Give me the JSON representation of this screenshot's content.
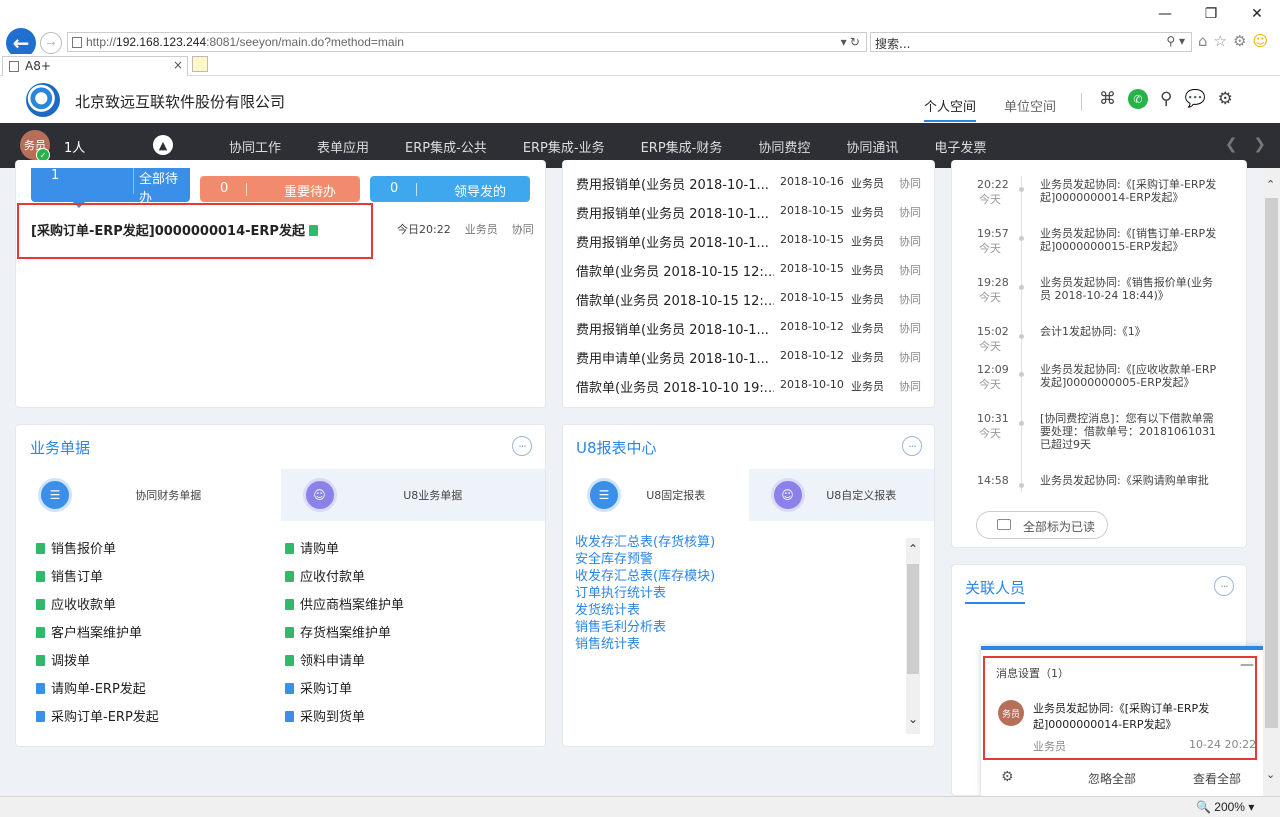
{
  "browser": {
    "url_prefix": "http://",
    "url_host": "192.168.123.244",
    "url_rest": ":8081/seeyon/main.do?method=main",
    "search_placeholder": "搜索...",
    "tab_title": "A8+",
    "zoom": "200%"
  },
  "header": {
    "company": "北京致远互联软件股份有限公司",
    "space_tabs": [
      "个人空间",
      "单位空间"
    ]
  },
  "nav": {
    "avatar_text": "务员",
    "user_count": "1人",
    "items": [
      "协同工作",
      "表单应用",
      "ERP集成-公共",
      "ERP集成-业务",
      "ERP集成-财务",
      "协同费控",
      "协同通讯",
      "电子发票"
    ]
  },
  "todo": {
    "all": {
      "count": "1",
      "label": "全部待办"
    },
    "important": {
      "count": "0",
      "label": "重要待办"
    },
    "leader": {
      "count": "0",
      "label": "领导发的"
    },
    "item": {
      "title": "[采购订单-ERP发起]0000000014-ERP发起",
      "time": "今日20:22",
      "user": "业务员",
      "type": "协同"
    }
  },
  "expenses": [
    {
      "title": "费用报销单(业务员 2018-10-1...",
      "date": "2018-10-16",
      "user": "业务员",
      "type": "协同"
    },
    {
      "title": "费用报销单(业务员 2018-10-1...",
      "date": "2018-10-15",
      "user": "业务员",
      "type": "协同"
    },
    {
      "title": "费用报销单(业务员 2018-10-1...",
      "date": "2018-10-15",
      "user": "业务员",
      "type": "协同"
    },
    {
      "title": "借款单(业务员 2018-10-15 12:...",
      "date": "2018-10-15",
      "user": "业务员",
      "type": "协同"
    },
    {
      "title": "借款单(业务员 2018-10-15 12:...",
      "date": "2018-10-15",
      "user": "业务员",
      "type": "协同"
    },
    {
      "title": "费用报销单(业务员 2018-10-1...",
      "date": "2018-10-12",
      "user": "业务员",
      "type": "协同"
    },
    {
      "title": "费用申请单(业务员 2018-10-1...",
      "date": "2018-10-12",
      "user": "业务员",
      "type": "协同"
    },
    {
      "title": "借款单(业务员 2018-10-10 19:...",
      "date": "2018-10-10",
      "user": "业务员",
      "type": "协同"
    }
  ],
  "timeline": {
    "today": "今天",
    "items": [
      {
        "time": "20:22",
        "text": "业务员发起协同:《[采购订单-ERP发起]0000000014-ERP发起》"
      },
      {
        "time": "19:57",
        "text": "业务员发起协同:《[销售订单-ERP发起]0000000015-ERP发起》"
      },
      {
        "time": "19:28",
        "text": "业务员发起协同:《销售报价单(业务员 2018-10-24 18:44)》"
      },
      {
        "time": "15:02",
        "text": "会计1发起协同:《1》"
      },
      {
        "time": "12:09",
        "text": "业务员发起协同:《[应收收款单-ERP发起]0000000005-ERP发起》"
      },
      {
        "time": "10:31",
        "text": "[协同费控消息]：您有以下借款单需要处理：借款单号：20181061031已超过9天"
      },
      {
        "time": "14:58",
        "text": "业务员发起协同:《采购请购单审批"
      }
    ],
    "mark_all_read": "全部标为已读"
  },
  "business": {
    "title": "业务单据",
    "tabs": [
      "协同财务单据",
      "U8业务单据"
    ],
    "left_items": [
      "销售报价单",
      "销售订单",
      "应收收款单",
      "客户档案维护单",
      "调拨单",
      "请购单-ERP发起",
      "采购订单-ERP发起"
    ],
    "right_items": [
      "请购单",
      "应收付款单",
      "供应商档案维护单",
      "存货档案维护单",
      "领料申请单",
      "采购订单",
      "采购到货单"
    ]
  },
  "reports": {
    "title": "U8报表中心",
    "tabs": [
      "U8固定报表",
      "U8自定义报表"
    ],
    "items": [
      "收发存汇总表(存货核算)",
      "安全库存预警",
      "收发存汇总表(库存模块)",
      "订单执行统计表",
      "发货统计表",
      "销售毛利分析表",
      "销售统计表"
    ]
  },
  "related": {
    "title": "关联人员"
  },
  "message": {
    "settings": "消息设置（1）",
    "avatar": "务员",
    "text": "业务员发起协同:《[采购订单-ERP发起]0000000014-ERP发起》",
    "from": "业务员",
    "time": "10-24 20:22",
    "ignore_all": "忽略全部",
    "view_all": "查看全部"
  }
}
